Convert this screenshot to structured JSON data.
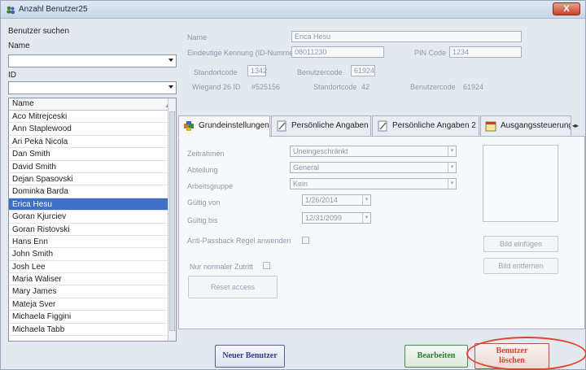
{
  "window": {
    "title": "Anzahl Benutzer25",
    "close_label": "X"
  },
  "search": {
    "heading": "Benutzer suchen",
    "name_label": "Name",
    "name_value": "",
    "id_label": "ID",
    "id_value": ""
  },
  "user_list": {
    "column_header": "Name",
    "items": [
      "Aco Mitrejceski",
      "Ann Staplewood",
      "Ari Peka Nicola",
      "Dan Smith",
      "David Smith",
      "Dejan Spasovski",
      "Dominka Barda",
      "Erica Hesu",
      "Goran Kjurciev",
      "Goran Ristovski",
      "Hans Enn",
      "John Smith",
      "Josh Lee",
      "Maria Waliser",
      "Mary James",
      "Mateja Sver",
      "Michaela Figgini",
      "Michaela Tabb"
    ],
    "selected_index": 7
  },
  "details": {
    "name_label": "Name",
    "name_value": "Erica Hesu",
    "id_label": "Eindeutige Kennung (ID-Nummer)",
    "id_value": "08011230",
    "pin_label": "PIN Code",
    "pin_value": "1234",
    "site_code_label": "Standortcode",
    "site_code_value": "1342",
    "user_code_label": "Benutzercode",
    "user_code_value": "61924",
    "wiegand_label": "Wiegand 26 ID",
    "wiegand_value": "#525156",
    "site_code2_label": "Standortcode",
    "site_code2_value": "42",
    "service_code_label": "Benutzercode",
    "service_code_value": "61924"
  },
  "tabs": [
    {
      "label": "Grundeinstellungen",
      "icon": "puzzle-icon",
      "active": true
    },
    {
      "label": "Persönliche Angaben",
      "icon": "doc-pen-icon",
      "active": false
    },
    {
      "label": "Persönliche Angaben 2",
      "icon": "doc-pen-icon",
      "active": false
    },
    {
      "label": "Ausgangssteuerung",
      "icon": "calendar-icon",
      "active": false
    }
  ],
  "settings": {
    "time_profile_label": "Zeitrahmen",
    "time_profile_value": "Uneingeschränkt",
    "department_label": "Abteilung",
    "department_value": "General",
    "workgroup_label": "Arbeitsgruppe",
    "workgroup_value": "Kein",
    "valid_from_label": "Gültig von",
    "valid_from_value": "1/26/2014",
    "valid_to_label": "Gültig bis",
    "valid_to_value": "12/31/2099",
    "anti_passback_label": "Anti-Passback Regel anwenden",
    "normal_access_label": "Nur normaler Zutritt",
    "reset_access_label": "Reset access",
    "add_image_label": "Bild einfügen",
    "remove_image_label": "Bild entfernen"
  },
  "actions": {
    "new_user_label": "Neuer Benutzer",
    "edit_label": "Bearbeiten",
    "delete_label_1": "Benutzer",
    "delete_label_2": "löschen"
  },
  "colors": {
    "selected": "#3d6fc7",
    "delete_text": "#d8452b",
    "new_text": "#2a3d8c",
    "edit_text": "#2f7a2f"
  }
}
